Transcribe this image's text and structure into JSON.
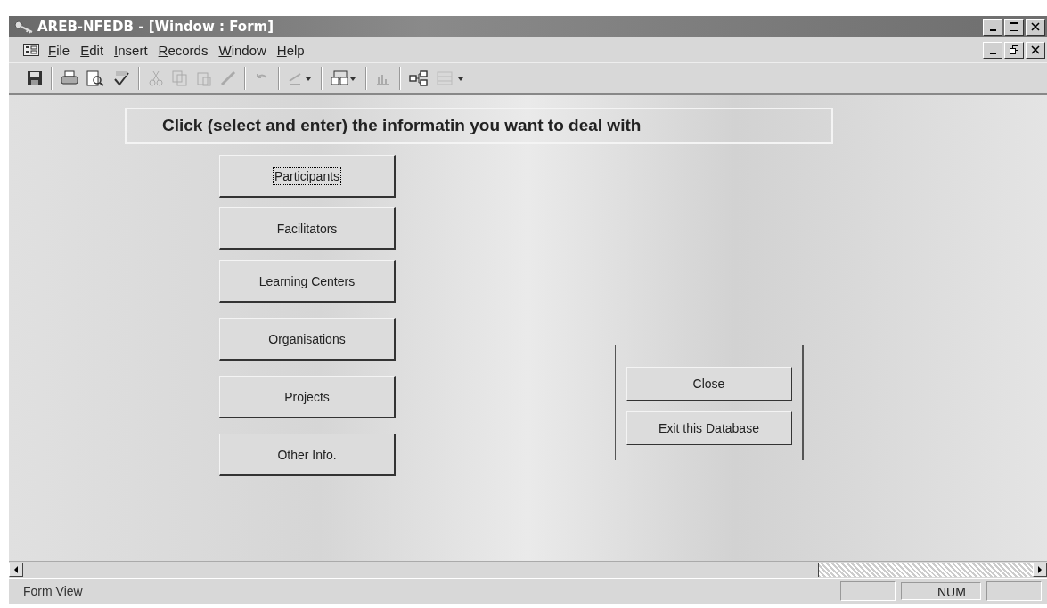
{
  "window": {
    "title": "AREB-NFEDB - [Window : Form]"
  },
  "menu": [
    {
      "label": "File"
    },
    {
      "label": "Edit"
    },
    {
      "label": "Insert"
    },
    {
      "label": "Records"
    },
    {
      "label": "Window"
    },
    {
      "label": "Help"
    }
  ],
  "form": {
    "heading": "Click (select and enter) the informatin you want to deal with",
    "buttons": [
      {
        "label": "Participants",
        "focused": true
      },
      {
        "label": "Facilitators",
        "focused": false
      },
      {
        "label": "Learning Centers",
        "focused": false
      },
      {
        "label": "Organisations",
        "focused": false
      },
      {
        "label": "Projects",
        "focused": false
      },
      {
        "label": "Other Info.",
        "focused": false
      }
    ],
    "panel_buttons": [
      {
        "label": "Close"
      },
      {
        "label": "Exit this Database"
      }
    ]
  },
  "status_bar": {
    "text": "Form View",
    "indicator": "NUM"
  }
}
